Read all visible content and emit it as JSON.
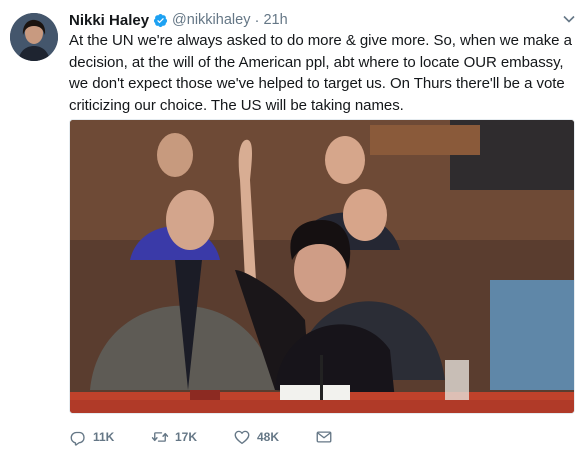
{
  "tweet": {
    "author_name": "Nikki Haley",
    "handle": "@nikkihaley",
    "separator": "·",
    "time": "21h",
    "text": "At the UN we're always asked to do more & give more. So, when we make a decision, at the will of the American ppl, abt where to locate OUR embassy, we don't expect those we've helped to target us. On Thurs there'll be a vote criticizing our choice. The US will be taking names."
  },
  "icons": {
    "verified": "verified-badge-icon",
    "caret": "chevron-down-icon",
    "reply": "reply-icon",
    "retweet": "retweet-icon",
    "like": "heart-icon",
    "dm": "envelope-icon"
  },
  "actions": {
    "reply_count": "11K",
    "retweet_count": "17K",
    "like_count": "48K"
  },
  "colors": {
    "accent": "#1da1f2",
    "muted": "#657786",
    "text": "#14171a"
  }
}
